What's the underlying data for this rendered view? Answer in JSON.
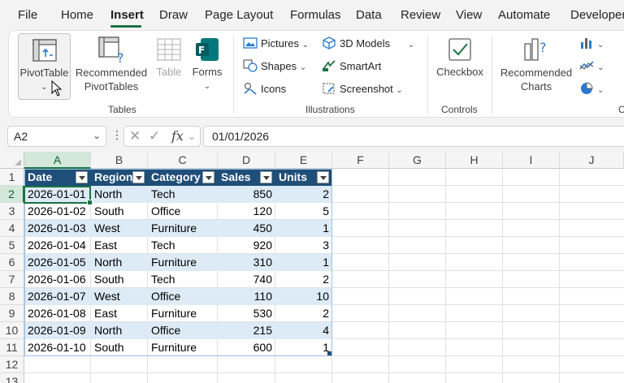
{
  "menu": {
    "tabs": [
      "File",
      "Home",
      "Insert",
      "Draw",
      "Page Layout",
      "Formulas",
      "Data",
      "Review",
      "View",
      "Automate",
      "Developer"
    ],
    "active": "Insert"
  },
  "ribbon": {
    "tables": {
      "pivot_table": "PivotTable",
      "recommended_line1": "Recommended",
      "recommended_line2": "PivotTables",
      "table": "Table",
      "forms": "Forms",
      "group_label": "Tables"
    },
    "illustrations": {
      "pictures": "Pictures",
      "shapes": "Shapes",
      "icons": "Icons",
      "models_3d": "3D Models",
      "smartart": "SmartArt",
      "screenshot": "Screenshot",
      "group_label": "Illustrations"
    },
    "controls": {
      "checkbox": "Checkbox",
      "group_label": "Controls"
    },
    "charts": {
      "recommended_line1": "Recommended",
      "recommended_line2": "Charts",
      "group_label": "C"
    }
  },
  "formula_bar": {
    "name_box": "A2",
    "fx": "fx",
    "value": "01/01/2026"
  },
  "sheet": {
    "columns": [
      "A",
      "B",
      "C",
      "D",
      "E",
      "F",
      "G",
      "H",
      "I",
      "J"
    ],
    "rows": [
      "1",
      "2",
      "3",
      "4",
      "5",
      "6",
      "7",
      "8",
      "9",
      "10",
      "11",
      "12",
      "13"
    ],
    "headers": [
      "Date",
      "Region",
      "Category",
      "Sales",
      "Units"
    ],
    "data": [
      [
        "2026-01-01",
        "North",
        "Tech",
        "850",
        "2"
      ],
      [
        "2026-01-02",
        "South",
        "Office",
        "120",
        "5"
      ],
      [
        "2026-01-03",
        "West",
        "Furniture",
        "450",
        "1"
      ],
      [
        "2026-01-04",
        "East",
        "Tech",
        "920",
        "3"
      ],
      [
        "2026-01-05",
        "North",
        "Furniture",
        "310",
        "1"
      ],
      [
        "2026-01-06",
        "South",
        "Tech",
        "740",
        "2"
      ],
      [
        "2026-01-07",
        "West",
        "Office",
        "110",
        "10"
      ],
      [
        "2026-01-08",
        "East",
        "Furniture",
        "530",
        "2"
      ],
      [
        "2026-01-09",
        "North",
        "Office",
        "215",
        "4"
      ],
      [
        "2026-01-10",
        "South",
        "Furniture",
        "600",
        "1"
      ]
    ],
    "active_cell": "A2"
  },
  "colors": {
    "accent": "#1a7343",
    "table_header": "#1f4e78",
    "table_band": "#ddebf7"
  }
}
